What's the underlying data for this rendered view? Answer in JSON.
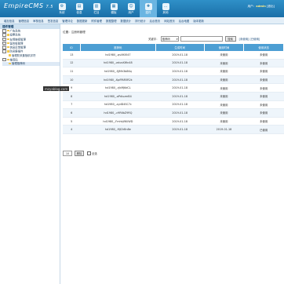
{
  "header": {
    "logo_main": "EmpireCMS",
    "logo_sub": "7.5",
    "user_label": "用户：",
    "user_name": "admin",
    "logout": "[退出]"
  },
  "topnav": [
    {
      "label": "系统"
    },
    {
      "label": "信息"
    },
    {
      "label": "栏目"
    },
    {
      "label": "模板"
    },
    {
      "label": "用户"
    },
    {
      "label": "插件"
    },
    {
      "label": "其他"
    }
  ],
  "menubar": [
    "增加信息",
    "管理信息",
    "审核信息",
    "签发信息",
    "管理评论",
    "数据更新",
    "附件管理",
    "数据整理",
    "数据统计",
    "排行统计",
    "后台首页",
    "网站首页",
    "后台地图",
    "版本更新"
  ],
  "sidebar": {
    "title": "插件管理",
    "tree": [
      {
        "label": "广告系统",
        "level": 1
      },
      {
        "label": "投票系统",
        "level": 1
      },
      {
        "label": "友情链接管理",
        "level": 1
      },
      {
        "label": "留言板管理",
        "level": 1
      },
      {
        "label": "信息反馈管理",
        "level": 1
      },
      {
        "label": "防采集插件",
        "level": 1
      },
      {
        "label": "管理防采集随机字符",
        "level": 2
      },
      {
        "label": "推荐码",
        "level": 1
      },
      {
        "label": "管理推荐码",
        "level": 2
      }
    ]
  },
  "main": {
    "breadcrumb": "位置：注册码管理",
    "search_label": "关键字：",
    "search_select": "推荐码",
    "search_btn": "搜索",
    "search_links": "[未使用] [已使用]",
    "columns": [
      "ID",
      "推荐码",
      "生成时间",
      "使用时间",
      "使用状态"
    ],
    "rows": [
      [
        "13",
        "hd1980_-qvXKt547",
        "2019-01-18",
        "未使用",
        "未使用"
      ],
      [
        "12",
        "hd1980_-wkvzXWn48",
        "2019-01-18",
        "未使用",
        "未使用"
      ],
      [
        "11",
        "hd1980_-fjJMh3b8Kq",
        "2019-01-18",
        "未使用",
        "未使用"
      ],
      [
        "10",
        "hd1980_-KpfPAR5R2k",
        "2019-01-18",
        "未使用",
        "未使用"
      ],
      [
        "9",
        "hd1980_-rjkMJ6dCL",
        "2019-01-18",
        "未使用",
        "未使用"
      ],
      [
        "8",
        "hd1980_-aPdiuzmB4",
        "2019-01-18",
        "未使用",
        "未使用"
      ],
      [
        "7",
        "hd1980_-zydD4SC7c",
        "2019-01-18",
        "未使用",
        "未使用"
      ],
      [
        "6",
        "hd1980_-c9R6bZ9RQ",
        "2019-01-18",
        "未使用",
        "未使用"
      ],
      [
        "5",
        "hd1980_-Fmhkjf6UWD",
        "2019-01-18",
        "未使用",
        "未使用"
      ],
      [
        "4",
        "hd1980_-MJChBn8e",
        "2019-01-18",
        "2019-01-18",
        "已使用"
      ]
    ],
    "page_value": "10",
    "delete_btn": "删除",
    "select_all": "全选"
  },
  "watermark": "mzyablog.com"
}
